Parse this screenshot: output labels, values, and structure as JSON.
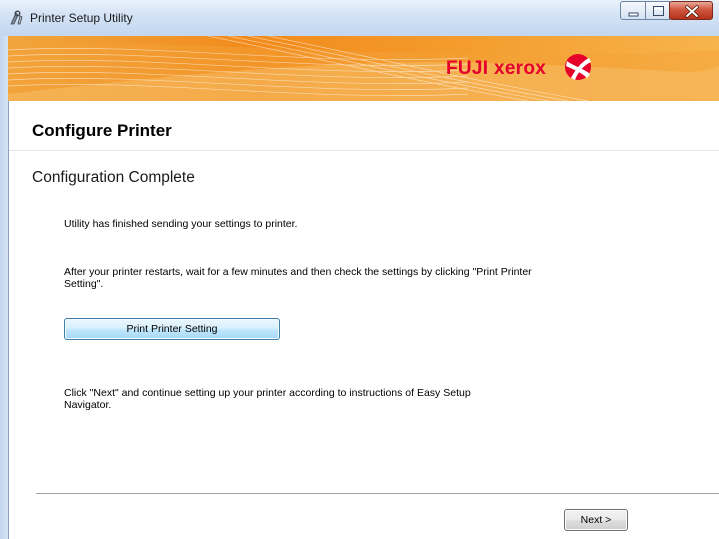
{
  "window": {
    "title": "Printer Setup Utility"
  },
  "banner": {
    "brand": "FUJI xerox",
    "brand_color": "#e4002b",
    "accent": "#f28c00"
  },
  "page": {
    "heading": "Configure Printer",
    "subheading": "Configuration Complete",
    "message1": "Utility has finished sending your settings to printer.",
    "message2": "After your printer restarts, wait for a few minutes and then check the settings by clicking \"Print Printer Setting\".",
    "print_button": "Print Printer Setting",
    "message3": "Click \"Next\" and continue setting up your printer according to instructions of Easy Setup Navigator."
  },
  "footer": {
    "next_button": "Next >"
  }
}
